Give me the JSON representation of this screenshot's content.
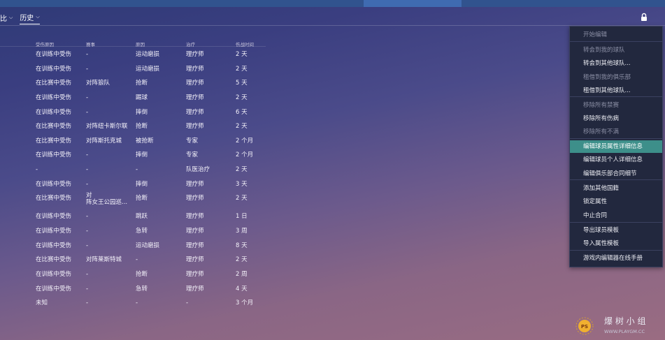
{
  "tabs": [
    {
      "label": "比",
      "active": false
    },
    {
      "label": "历史",
      "active": true
    }
  ],
  "table": {
    "headers": [
      "受伤原因",
      "赛事",
      "原因",
      "治疗",
      "伤战时间"
    ],
    "rows": [
      [
        "在训练中受伤",
        "-",
        "运动磨损",
        "理疗师",
        "2 天"
      ],
      [
        "在训练中受伤",
        "-",
        "运动磨损",
        "理疗师",
        "2 天"
      ],
      [
        "在比赛中受伤",
        "对阵狼队",
        "抢断",
        "理疗师",
        "5 天"
      ],
      [
        "在训练中受伤",
        "-",
        "踢球",
        "理疗师",
        "2 天"
      ],
      [
        "在训练中受伤",
        "-",
        "摔倒",
        "理疗师",
        "6 天"
      ],
      [
        "在比赛中受伤",
        "对阵纽卡斯尔联",
        "抢断",
        "理疗师",
        "2 天"
      ],
      [
        "在比赛中受伤",
        "对阵斯托克城",
        "被抢断",
        "专家",
        "2 个月"
      ],
      [
        "在训练中受伤",
        "-",
        "摔倒",
        "专家",
        "2 个月"
      ],
      [
        "-",
        "-",
        "-",
        "队医治疗",
        "2 天"
      ],
      [
        "在训练中受伤",
        "-",
        "摔倒",
        "理疗师",
        "3 天"
      ],
      [
        "在比赛中受伤",
        "对\n阵女王公园巡...",
        "抢断",
        "理疗师",
        "2 天"
      ],
      [
        "在训练中受伤",
        "-",
        "跳跃",
        "理疗师",
        "1 日"
      ],
      [
        "在训练中受伤",
        "-",
        "急转",
        "理疗师",
        "3 周"
      ],
      [
        "在训练中受伤",
        "-",
        "运动磨损",
        "理疗师",
        "8 天"
      ],
      [
        "在比赛中受伤",
        "对阵莱斯特城",
        "-",
        "理疗师",
        "2 天"
      ],
      [
        "在训练中受伤",
        "-",
        "抢断",
        "理疗师",
        "2 周"
      ],
      [
        "在训练中受伤",
        "-",
        "急转",
        "理疗师",
        "4 天"
      ],
      [
        "未知",
        "-",
        "-",
        "-",
        "3 个月"
      ]
    ]
  },
  "menu": {
    "items": [
      {
        "label": "开始编辑",
        "disabled": true
      },
      {
        "label": "转会到我的球队",
        "disabled": true
      },
      {
        "label": "转会到其他球队...",
        "disabled": false
      },
      {
        "label": "租借到我的俱乐部",
        "disabled": true
      },
      {
        "label": "租借到其他球队...",
        "disabled": false
      },
      {
        "label": "移除所有禁赛",
        "disabled": true
      },
      {
        "label": "移除所有伤病",
        "disabled": false
      },
      {
        "label": "移除所有不满",
        "disabled": true
      },
      {
        "label": "编辑球员属性详细信息",
        "disabled": false,
        "highlighted": true
      },
      {
        "label": "编辑球员个人详细信息",
        "disabled": false
      },
      {
        "label": "编辑俱乐部合同细节",
        "disabled": false
      },
      {
        "label": "添加其他国籍",
        "disabled": false
      },
      {
        "label": "锁定属性",
        "disabled": false
      },
      {
        "label": "中止合同",
        "disabled": false
      },
      {
        "label": "导出球员模板",
        "disabled": false
      },
      {
        "label": "导入属性模板",
        "disabled": false
      },
      {
        "label": "游戏内编辑器在线手册",
        "disabled": false
      }
    ]
  },
  "watermark": {
    "text": "爆 树 小 组",
    "url": "WWW.PLAYGM.CC",
    "badge": "PS"
  },
  "icons": {
    "lock": "lock-icon",
    "chevron": "chevron-down-icon"
  },
  "colors": {
    "highlight": "#3d8f8a",
    "menu_bg": "#22283e",
    "topbar": "#31538e"
  }
}
